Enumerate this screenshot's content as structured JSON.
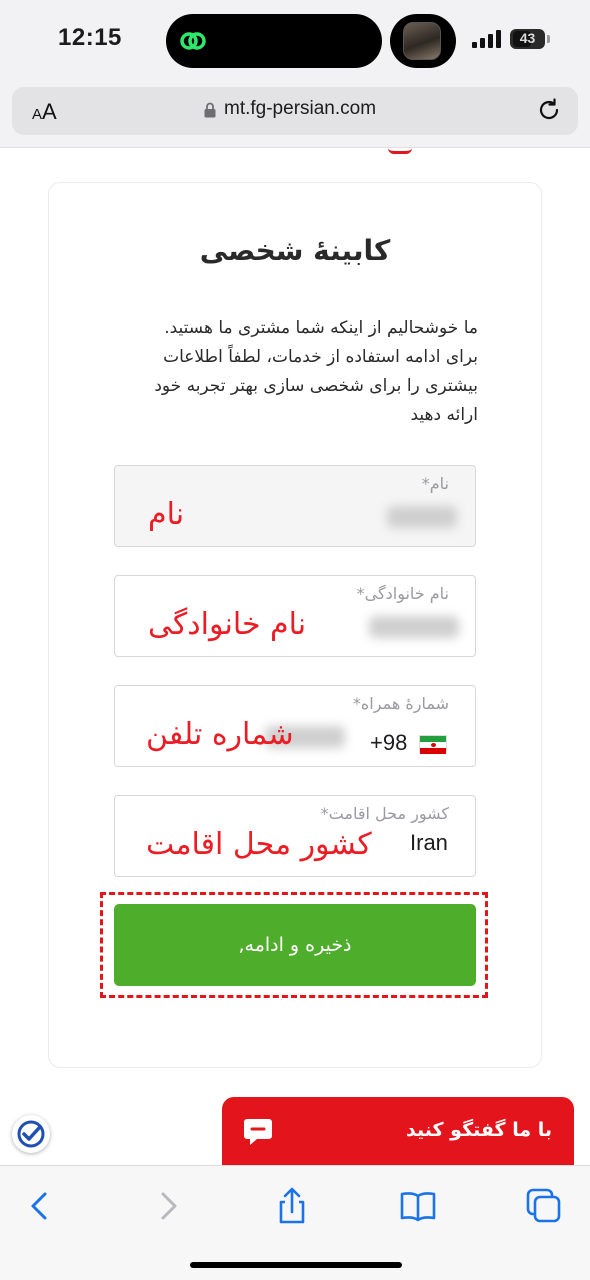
{
  "status_bar": {
    "time": "12:15",
    "battery": "43"
  },
  "browser": {
    "aa_large": "A",
    "aa_small": "A",
    "url": "mt.fg-persian.com"
  },
  "page": {
    "title": "کابینهٔ شخصی",
    "intro": "ما خوشحالیم از اینکه شما مشتری ما هستید. برای ادامه استفاده از خدمات، لطفاً اطلاعات بیشتری را برای شخصی سازی بهتر تجربه خود ارائه دهید",
    "fields": {
      "first_name": {
        "label": "نام*",
        "annotation": "نام"
      },
      "last_name": {
        "label": "نام خانوادگی*",
        "annotation": "نام خانوادگی"
      },
      "phone": {
        "label": "شمارهٔ همراه*",
        "code": "+98",
        "annotation": "شماره تلفن"
      },
      "country": {
        "label": "کشور محل اقامت*",
        "value": "Iran",
        "annotation": "کشور محل اقامت"
      }
    },
    "submit_label": "ذخیره و ادامه,"
  },
  "chat": {
    "label": "با ما گفتگو کنید"
  },
  "colors": {
    "accent_green": "#4fad2c",
    "brand_red": "#e3141b",
    "annotation_red": "#ec1c24"
  }
}
